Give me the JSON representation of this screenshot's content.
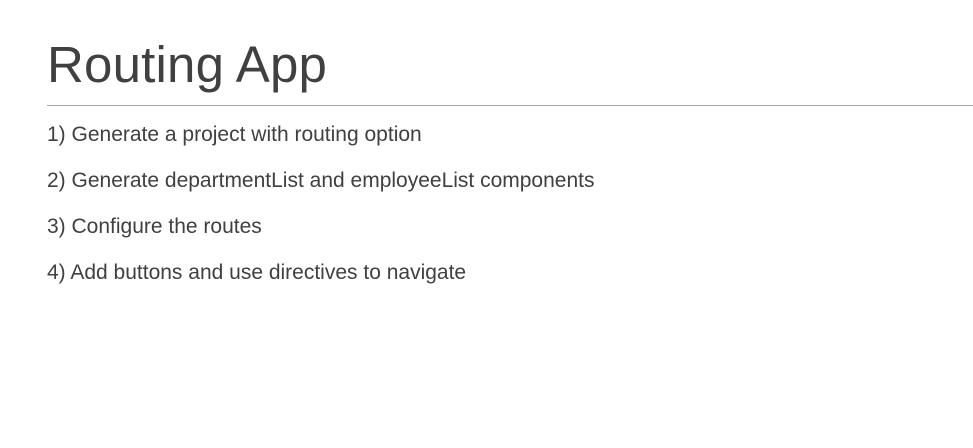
{
  "slide": {
    "title": "Routing App",
    "steps": [
      "1) Generate a project with routing option",
      "2) Generate departmentList and employeeList components",
      "3) Configure the routes",
      "4) Add buttons and use directives to navigate"
    ]
  },
  "colors": {
    "text": "#404040",
    "rule": "#a6a6a6",
    "background": "#ffffff"
  }
}
